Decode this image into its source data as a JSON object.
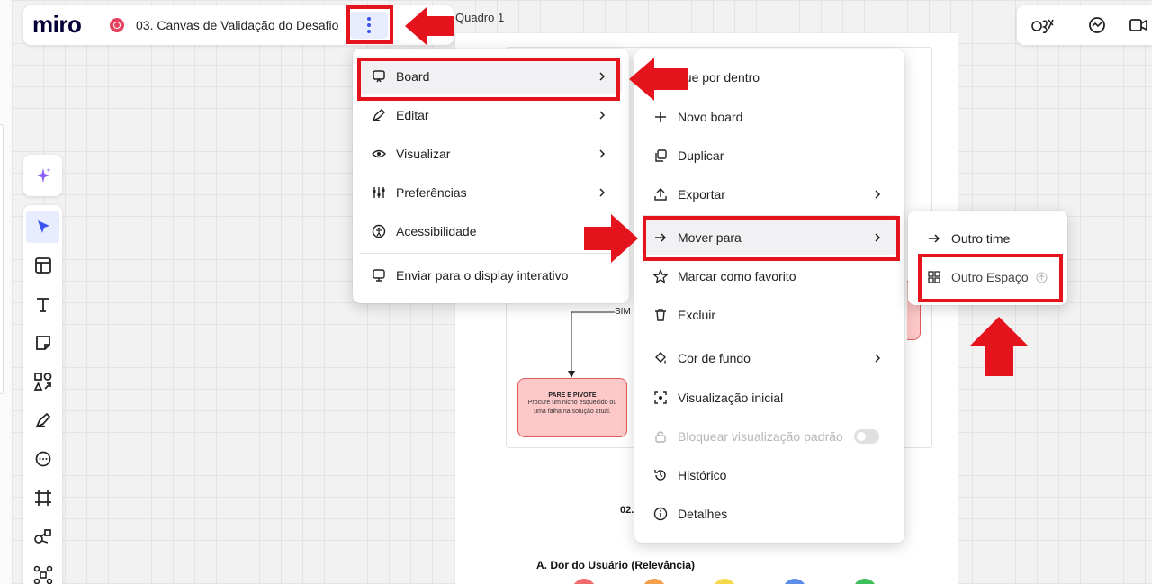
{
  "app": {
    "logo": "miro",
    "board_title": "03. Canvas de Validação do Desafio",
    "frame_label": "Quadro 1"
  },
  "colors": {
    "accent": "#3b54f0",
    "annotation_red": "#e5141c",
    "board_icon": "#e4435f",
    "pivot_fill": "#ffc8c8"
  },
  "top_right": {
    "icons": [
      "reactions-icon",
      "comment-icon",
      "video-icon"
    ]
  },
  "toolbar": {
    "ai_icon": "sparkle-icon",
    "tools": [
      "select-icon",
      "templates-icon",
      "text-icon",
      "sticky-note-icon",
      "shapes-icon",
      "pen-icon",
      "comment-icon",
      "frame-icon",
      "mindmap-icon",
      "more-icon"
    ]
  },
  "main_menu": {
    "items": [
      {
        "label": "Board",
        "icon": "board-icon",
        "submenu": true
      },
      {
        "label": "Editar",
        "icon": "pen-icon",
        "submenu": true
      },
      {
        "label": "Visualizar",
        "icon": "eye-icon",
        "submenu": true
      },
      {
        "label": "Preferências",
        "icon": "sliders-icon",
        "submenu": true
      },
      {
        "label": "Acessibilidade",
        "icon": "accessibility-icon",
        "submenu": false
      },
      {
        "label": "Enviar para o display interativo",
        "icon": "display-icon",
        "submenu": false
      }
    ]
  },
  "board_menu": {
    "items": [
      {
        "label": "que por dentro",
        "icon": ""
      },
      {
        "label": "Novo board",
        "icon": "plus-icon"
      },
      {
        "label": "Duplicar",
        "icon": "duplicate-icon"
      },
      {
        "label": "Exportar",
        "icon": "export-icon",
        "submenu": true
      },
      {
        "label": "Mover para",
        "icon": "arrow-right-icon",
        "submenu": true
      },
      {
        "label": "Marcar como favorito",
        "icon": "star-icon"
      },
      {
        "label": "Excluir",
        "icon": "trash-icon"
      },
      {
        "label": "Cor de fundo",
        "icon": "paint-bucket-icon",
        "submenu": true
      },
      {
        "label": "Visualização inicial",
        "icon": "focus-icon"
      },
      {
        "label": "Bloquear visualização padrão",
        "icon": "lock-icon",
        "disabled": true
      },
      {
        "label": "Histórico",
        "icon": "history-icon"
      },
      {
        "label": "Detalhes",
        "icon": "info-icon"
      }
    ]
  },
  "move_menu": {
    "items": [
      {
        "label": "Outro time",
        "icon": "arrow-right-icon"
      },
      {
        "label": "Outro Espaço",
        "icon": "grid-icon",
        "badge": "upgrade-icon"
      }
    ]
  },
  "canvas": {
    "pivot_title": "PARE E PIVOTE",
    "pivot_desc": "Procure um nicho esquecido ou uma falha na solução atual.",
    "sim_label": "SIM",
    "section_number": "02.",
    "section_title": "A. Dor do Usuário (Relevância)",
    "dots": [
      "#f26b6b",
      "#f5a04a",
      "#f5d94a",
      "#5b8de8",
      "#3cbf5a"
    ]
  }
}
